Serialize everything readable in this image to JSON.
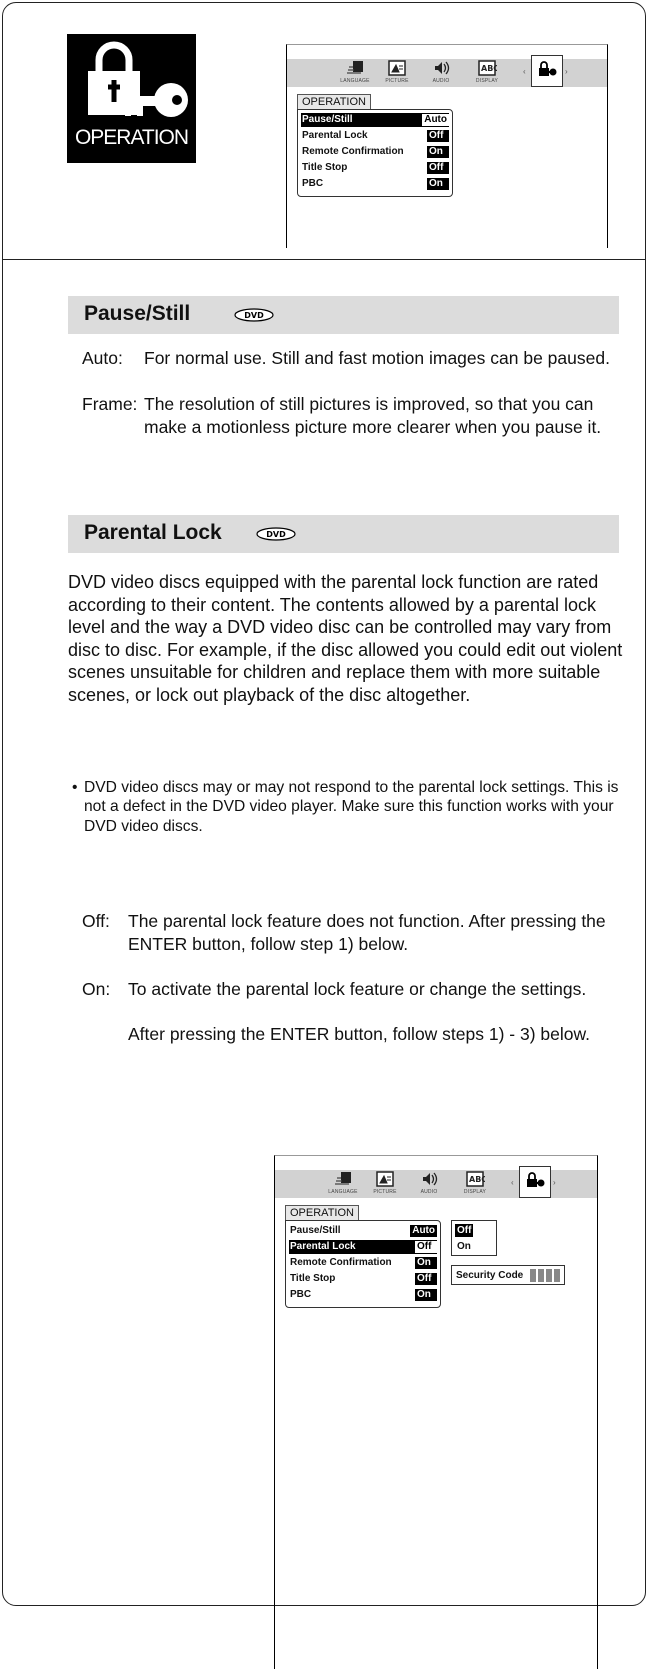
{
  "badge": {
    "icon": "lock-key-icon",
    "label": "OPERATION"
  },
  "osd_menu": {
    "tabs": [
      {
        "label": "LANGUAGE",
        "icon": "language-icon"
      },
      {
        "label": "PICTURE",
        "icon": "picture-icon"
      },
      {
        "label": "AUDIO",
        "icon": "audio-icon"
      },
      {
        "label": "DISPLAY",
        "icon": "display-icon"
      },
      {
        "label": "",
        "icon": "operation-lock-icon"
      }
    ],
    "section": "OPERATION",
    "items": [
      {
        "name": "Pause/Still",
        "value": "Auto"
      },
      {
        "name": "Parental Lock",
        "value": "Off"
      },
      {
        "name": "Remote Confirmation",
        "value": "On"
      },
      {
        "name": "Title Stop",
        "value": "Off"
      },
      {
        "name": "PBC",
        "value": "On"
      }
    ],
    "popup_options": [
      "Off",
      "On"
    ],
    "security_label": "Security Code"
  },
  "pause_still": {
    "heading": "Pause/Still",
    "badge": "DVD",
    "items": [
      {
        "term": "Auto:",
        "desc": "For normal use. Still and fast motion images can be paused."
      },
      {
        "term": "Frame:",
        "desc": "The resolution of still pictures is improved, so that you can make a motionless picture more clearer when you pause it."
      }
    ]
  },
  "parental_lock": {
    "heading": "Parental Lock",
    "badge": "DVD",
    "intro": "DVD video discs equipped with the parental lock function are rated according to their content. The contents allowed by a parental lock level and the way a DVD video disc can be controlled may vary from disc to disc. For example, if the disc allowed you could edit out violent scenes unsuitable for children and replace them with more suitable scenes, or lock out playback of the disc altogether.",
    "bullet_mark": "•",
    "bullet": "DVD video discs may or may not respond to the parental lock settings. This is not a defect in the DVD video player. Make sure this function works with your DVD video discs.",
    "items": [
      {
        "term": "Off:",
        "desc": "The parental lock feature does not function. After pressing the ENTER button, follow step 1) below."
      },
      {
        "term": "On:",
        "desc": "To activate the parental lock feature or change the settings.",
        "desc2": "After pressing the ENTER button, follow steps 1) - 3) below."
      }
    ]
  }
}
